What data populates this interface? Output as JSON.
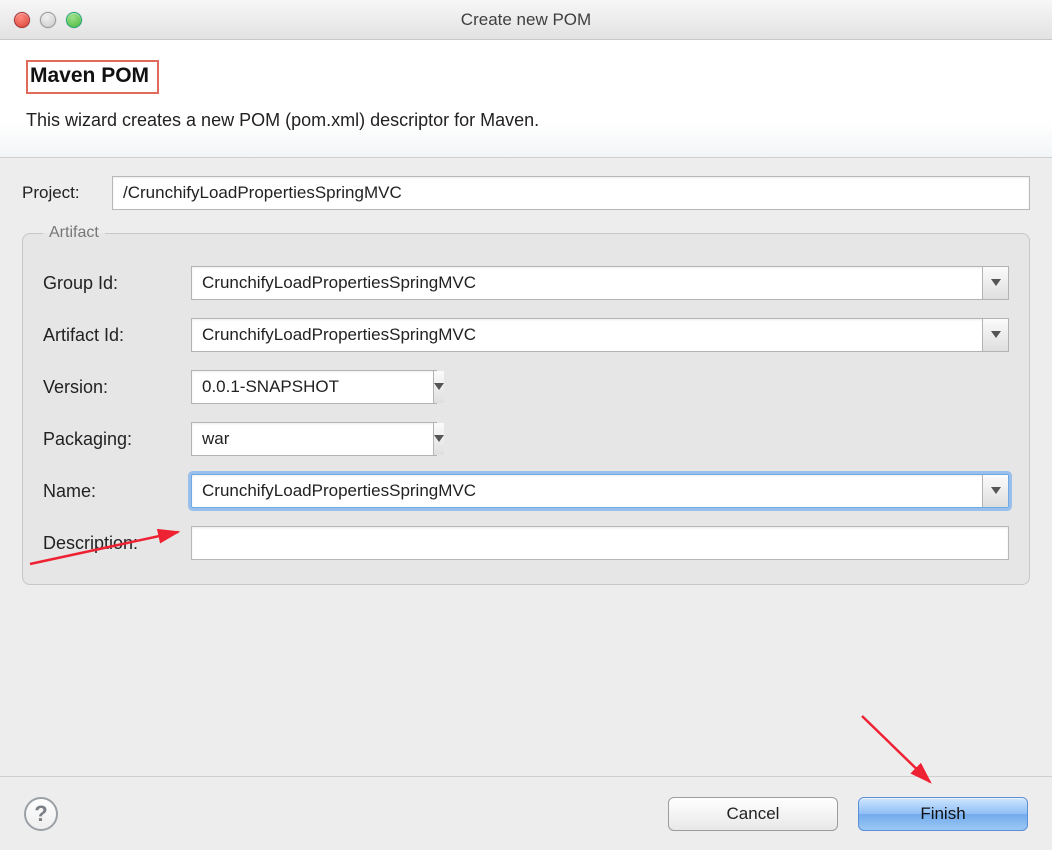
{
  "window": {
    "title": "Create new POM"
  },
  "header": {
    "title": "Maven POM",
    "subtitle": "This wizard creates a new POM (pom.xml) descriptor for Maven."
  },
  "project": {
    "label": "Project:",
    "value": "/CrunchifyLoadPropertiesSpringMVC"
  },
  "artifact": {
    "legend": "Artifact",
    "group_id": {
      "label": "Group Id:",
      "value": "CrunchifyLoadPropertiesSpringMVC"
    },
    "artifact_id": {
      "label": "Artifact Id:",
      "value": "CrunchifyLoadPropertiesSpringMVC"
    },
    "version": {
      "label": "Version:",
      "value": "0.0.1-SNAPSHOT"
    },
    "packaging": {
      "label": "Packaging:",
      "value": "war"
    },
    "name": {
      "label": "Name:",
      "value": "CrunchifyLoadPropertiesSpringMVC"
    },
    "description": {
      "label": "Description:",
      "value": ""
    }
  },
  "buttons": {
    "cancel": "Cancel",
    "finish": "Finish"
  }
}
